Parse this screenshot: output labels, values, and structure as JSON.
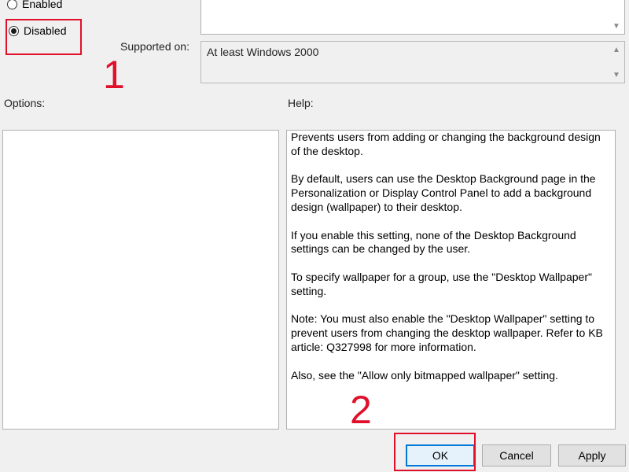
{
  "state": {
    "enabled_label": "Enabled",
    "disabled_label": "Disabled",
    "selected": "Disabled"
  },
  "supported": {
    "label": "Supported on:",
    "value": "At least Windows 2000"
  },
  "options": {
    "label": "Options:"
  },
  "help": {
    "label": "Help:",
    "paragraphs": [
      "Prevents users from adding or changing the background design of the desktop.",
      "By default, users can use the Desktop Background page in the Personalization or Display Control Panel to add a background design (wallpaper) to their desktop.",
      "If you enable this setting, none of the Desktop Background settings can be changed by the user.",
      "To specify wallpaper for a group, use the \"Desktop Wallpaper\" setting.",
      "Note: You must also enable the \"Desktop Wallpaper\" setting to prevent users from changing the desktop wallpaper. Refer to KB article: Q327998 for more information.",
      "Also, see the \"Allow only bitmapped wallpaper\" setting."
    ]
  },
  "buttons": {
    "ok": "OK",
    "cancel": "Cancel",
    "apply": "Apply"
  },
  "annotations": {
    "step1": "1",
    "step2": "2",
    "color": "#e0102a"
  },
  "icons": {
    "scroll_up": "chevron-up-icon",
    "scroll_down": "chevron-down-icon"
  }
}
